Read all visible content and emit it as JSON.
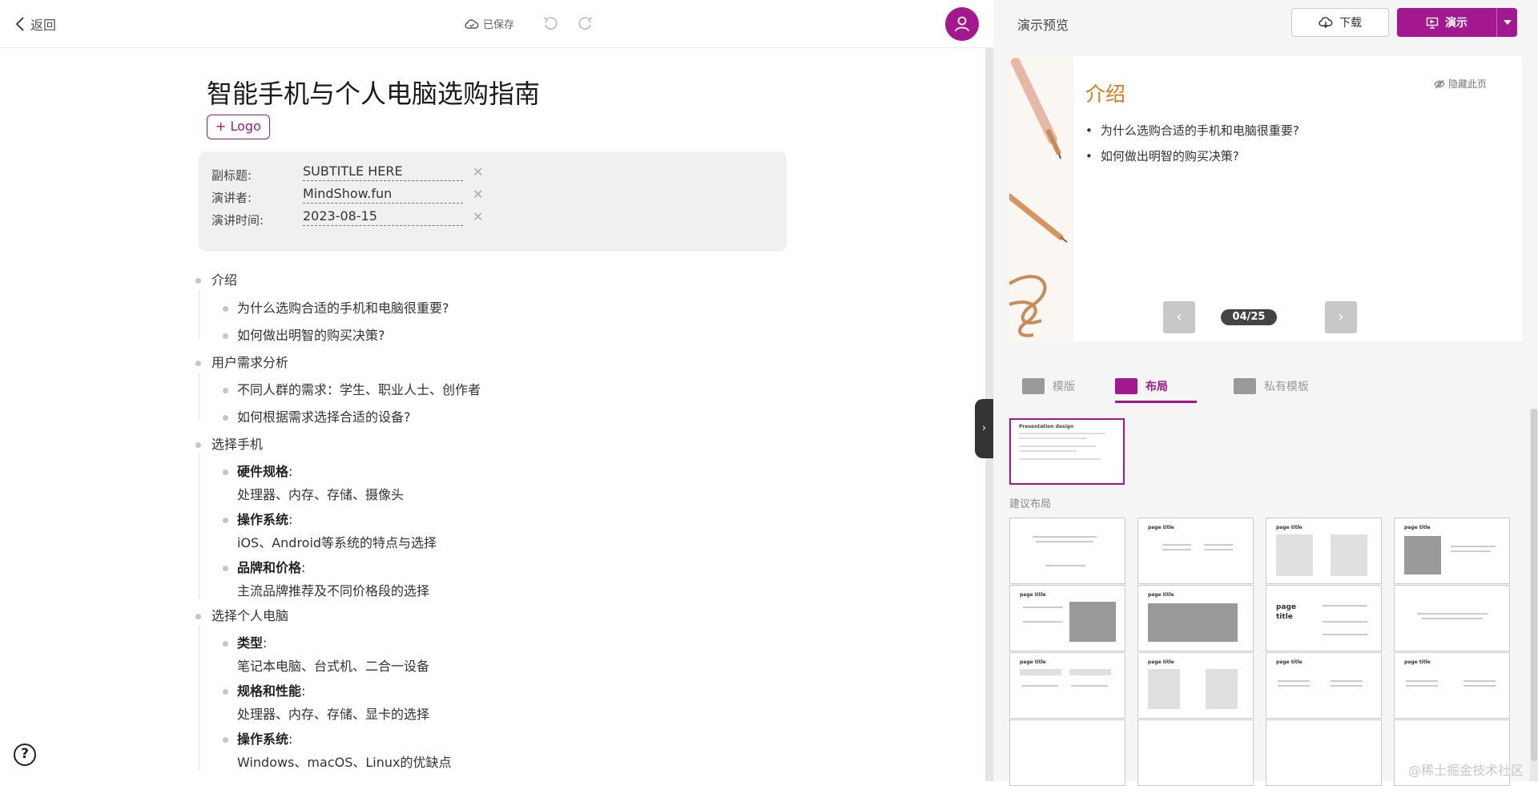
{
  "topbar": {
    "back_label": "返回",
    "save_status": "已保存"
  },
  "document": {
    "title": "智能手机与个人电脑选购指南",
    "logo_button": "+ Logo",
    "meta": [
      {
        "label": "副标题:",
        "value": "SUBTITLE HERE"
      },
      {
        "label": "演讲者:",
        "value": "MindShow.fun"
      },
      {
        "label": "演讲时间:",
        "value": "2023-08-15"
      }
    ]
  },
  "outline": {
    "s1": {
      "title": "介绍",
      "items": [
        "为什么选购合适的手机和电脑很重要?",
        "如何做出明智的购买决策?"
      ]
    },
    "s2": {
      "title": "用户需求分析",
      "items": [
        "不同人群的需求：学生、职业人士、创作者",
        "如何根据需求选择合适的设备?"
      ]
    },
    "s3": {
      "title": "选择手机",
      "items": [
        {
          "head": "硬件规格",
          "body": "处理器、内存、存储、摄像头"
        },
        {
          "head": "操作系统",
          "body": "iOS、Android等系统的特点与选择"
        },
        {
          "head": "品牌和价格",
          "body": "主流品牌推荐及不同价格段的选择"
        }
      ]
    },
    "s4": {
      "title": "选择个人电脑",
      "items": [
        {
          "head": "类型",
          "body": "笔记本电脑、台式机、二合一设备"
        },
        {
          "head": "规格和性能",
          "body": "处理器、内存、存储、显卡的选择"
        },
        {
          "head": "操作系统",
          "body": "Windows、macOS、Linux的优缺点"
        }
      ]
    },
    "colon": ":"
  },
  "panel": {
    "title": "演示预览",
    "download_label": "下载",
    "present_label": "演示",
    "slide": {
      "heading": "介绍",
      "hide_label": "隐藏此页",
      "bullets": [
        "为什么选购合适的手机和电脑很重要?",
        "如何做出明智的购买决策?"
      ],
      "counter": "04/25"
    },
    "tabs": {
      "templates": "模版",
      "layouts": "布局",
      "private": "私有模板"
    },
    "current_layout_title": "Presentation design",
    "suggest_label": "建议布局",
    "thumb_title": "page title",
    "thumb_title_alt": "page",
    "thumb_title_alt2": "title"
  },
  "watermark": "@稀土掘金技术社区",
  "colors": {
    "accent": "#a2188f",
    "slide_heading": "#e07b1d"
  }
}
